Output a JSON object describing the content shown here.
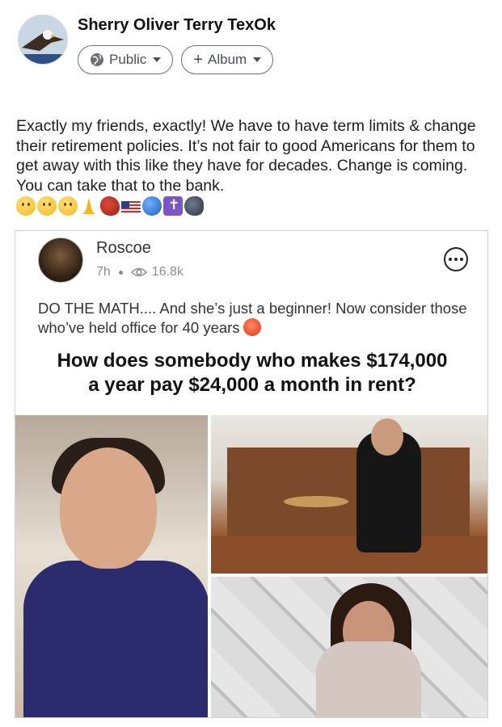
{
  "post": {
    "author": "Sherry Oliver Terry TexOk",
    "audience_label": "Public",
    "album_label": "Album",
    "text": "Exactly my friends, exactly! We have to have term limits & change their retirement policies. It’s not fair to good Americans for them to get away with this like they have for decades. Change is coming. You can take that to the bank.",
    "emojis": [
      "angry-face",
      "woozy-face",
      "thinking-face",
      "folded-hands",
      "boxing-glove",
      "us-flag",
      "globe",
      "latin-cross",
      "speaking-head"
    ]
  },
  "shared": {
    "author": "Roscoe",
    "time": "7h",
    "views": "16.8k",
    "text": "DO THE MATH.... And she’s just a beginner! Now consider those who’ve held office for 40 years",
    "meme_title_line1": "How does somebody who makes $174,000",
    "meme_title_line2": "a year pay $24,000 a month in rent?"
  },
  "colors": {
    "text": "#1c1e21",
    "muted": "#8a8d91",
    "border": "#cfd2d6"
  }
}
